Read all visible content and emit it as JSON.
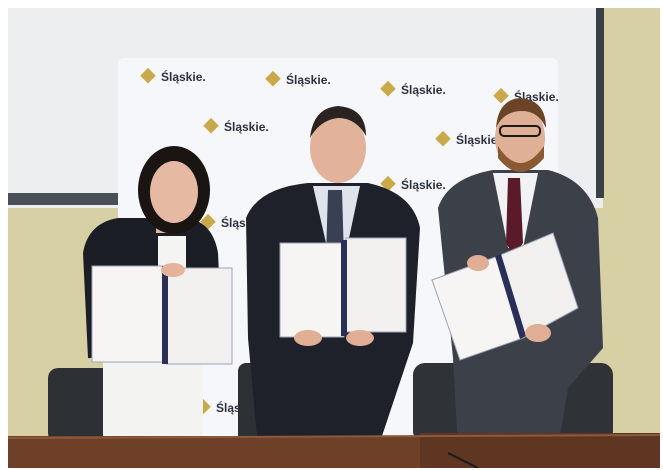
{
  "backdrop": {
    "logo_text": "Śląskie."
  },
  "colors": {
    "wall": "#d9d2a8",
    "whiteboard": "#eef0f2",
    "banner": "#f7f8fb",
    "table": "#6b3e26",
    "suit_dark": "#1f2230",
    "suit_grey": "#3a3f4a"
  }
}
